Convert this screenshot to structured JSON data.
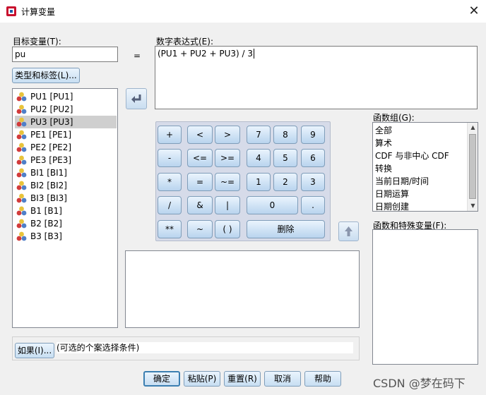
{
  "window": {
    "title": "计算变量"
  },
  "target": {
    "label": "目标变量(T):",
    "value": "pu",
    "type_label_button": "类型和标签(L)..."
  },
  "equals": "=",
  "expression": {
    "label": "数字表达式(E):",
    "value": "(PU1 + PU2 + PU3) / 3"
  },
  "variables": [
    {
      "label": "PU1 [PU1]",
      "selected": false
    },
    {
      "label": "PU2 [PU2]",
      "selected": false
    },
    {
      "label": "PU3 [PU3]",
      "selected": true
    },
    {
      "label": "PE1 [PE1]",
      "selected": false
    },
    {
      "label": "PE2 [PE2]",
      "selected": false
    },
    {
      "label": "PE3 [PE3]",
      "selected": false
    },
    {
      "label": "BI1 [BI1]",
      "selected": false
    },
    {
      "label": "BI2 [BI2]",
      "selected": false
    },
    {
      "label": "BI3 [BI3]",
      "selected": false
    },
    {
      "label": "B1 [B1]",
      "selected": false
    },
    {
      "label": "B2 [B2]",
      "selected": false
    },
    {
      "label": "B3 [B3]",
      "selected": false
    }
  ],
  "keypad": {
    "plus": "+",
    "lt": "<",
    "gt": ">",
    "k7": "7",
    "k8": "8",
    "k9": "9",
    "minus": "-",
    "le": "<=",
    "ge": ">=",
    "k4": "4",
    "k5": "5",
    "k6": "6",
    "times": "*",
    "eq": "=",
    "ne": "~=",
    "k1": "1",
    "k2": "2",
    "k3": "3",
    "div": "/",
    "and": "&",
    "or": "|",
    "k0": "0",
    "dot": ".",
    "pow": "**",
    "not": "~",
    "paren": "( )",
    "delete": "删除"
  },
  "function_group": {
    "label": "函数组(G):",
    "items": [
      "全部",
      "算术",
      "CDF 与非中心 CDF",
      "转换",
      "当前日期/时间",
      "日期运算",
      "日期创建"
    ]
  },
  "functions_label": "函数和特殊变量(F):",
  "condition": {
    "if_button": "如果(I)...",
    "text": "(可选的个案选择条件)"
  },
  "buttons": {
    "ok": "确定",
    "paste": "粘贴(P)",
    "reset": "重置(R)",
    "cancel": "取消",
    "help": "帮助"
  },
  "watermark": "CSDN @梦在码下"
}
